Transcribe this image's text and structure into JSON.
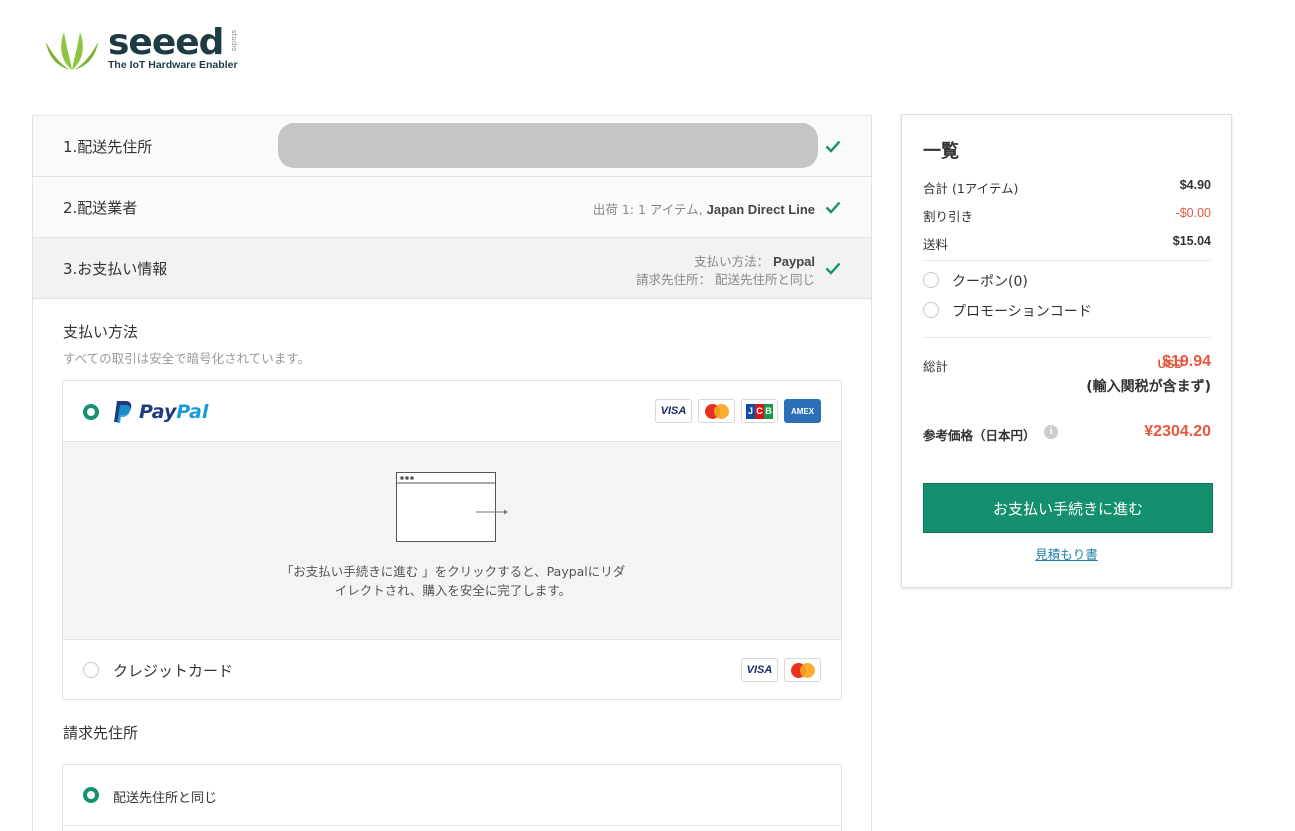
{
  "brand": {
    "name": "seeed",
    "tagline": "The IoT Hardware Enabler",
    "sub": "studio"
  },
  "steps": [
    {
      "title": "1.配送先住所"
    },
    {
      "title": "2.配送業者",
      "info_prefix": "出荷 1: 1 アイテム, ",
      "info_bold": "Japan Direct Line"
    },
    {
      "title": "3.お支払い情報",
      "line1_prefix": "支払い方法： ",
      "line1_bold": "Paypal",
      "line2": "請求先住所： 配送先住所と同じ"
    }
  ],
  "payment": {
    "heading": "支払い方法",
    "subheading": "すべての取引は安全で暗号化されています。",
    "paypal": {
      "pay": "Pay",
      "pal": "Pal",
      "selected": true
    },
    "paypal_cards": [
      "VISA",
      "MasterCard",
      "JCB",
      "AMEX"
    ],
    "redirect_text_line1": "「お支払い手続きに進む 」をクリックすると、Paypalにリダ",
    "redirect_text_line2": "イレクトされ、購入を安全に完了します。",
    "credit_label": "クレジットカード",
    "credit_cards": [
      "VISA",
      "MasterCard"
    ]
  },
  "billing": {
    "heading": "請求先住所",
    "option_same": "配送先住所と同じ"
  },
  "summary": {
    "title": "一覧",
    "subtotal_label": "合計 (1アイテム)",
    "subtotal_value": "$4.90",
    "discount_label": "割り引き",
    "discount_value": "-$0.00",
    "shipping_label": "送料",
    "shipping_value": "$15.04",
    "coupon_label": "クーポン(0)",
    "promo_label": "プロモーションコード",
    "total_label": "総計",
    "total_currency": "USD",
    "total_value": "$19.94",
    "total_note": "(輸入関税が含まず)",
    "reference_label": "参考価格（日本円）",
    "reference_value": "¥2304.20",
    "checkout_button": "お支払い手続きに進む",
    "quote_link": "見積もり書"
  },
  "colors": {
    "accent_green": "#14906f",
    "price_red": "#e8563d",
    "link_blue": "#1f7fa8"
  }
}
